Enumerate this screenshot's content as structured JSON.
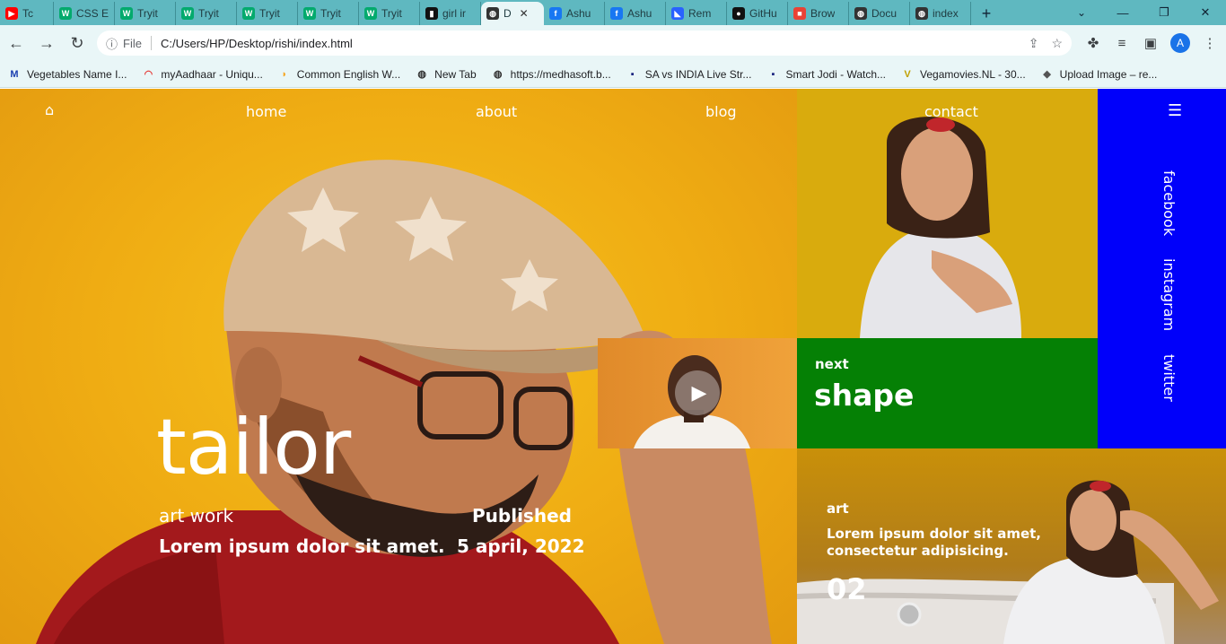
{
  "browser": {
    "tabs": [
      {
        "label": "Tc",
        "icon": "youtube-icon",
        "color": "#ff0000"
      },
      {
        "label": "CSS E",
        "icon": "w3schools-icon",
        "color": "#04aa6d"
      },
      {
        "label": "Tryit",
        "icon": "w3schools-icon",
        "color": "#04aa6d"
      },
      {
        "label": "Tryit",
        "icon": "w3schools-icon",
        "color": "#04aa6d"
      },
      {
        "label": "Tryit",
        "icon": "w3schools-icon",
        "color": "#04aa6d"
      },
      {
        "label": "Tryit",
        "icon": "w3schools-icon",
        "color": "#04aa6d"
      },
      {
        "label": "Tryit",
        "icon": "w3schools-icon",
        "color": "#04aa6d"
      },
      {
        "label": "girl ir",
        "icon": "unsplash-icon",
        "color": "#111111"
      },
      {
        "label": "D",
        "icon": "globe-icon",
        "color": "#333333",
        "active": true
      },
      {
        "label": "Ashu",
        "icon": "facebook-icon",
        "color": "#1877f2"
      },
      {
        "label": "Ashu",
        "icon": "facebook-icon",
        "color": "#1877f2"
      },
      {
        "label": "Rem",
        "icon": "remini-icon",
        "color": "#2962ff"
      },
      {
        "label": "GitHu",
        "icon": "github-icon",
        "color": "#111111"
      },
      {
        "label": "Brow",
        "icon": "multicolor-icon",
        "color": "#e94235"
      },
      {
        "label": "Docu",
        "icon": "globe-icon",
        "color": "#333333"
      },
      {
        "label": "index",
        "icon": "globe-icon",
        "color": "#333333"
      }
    ],
    "address": {
      "scheme_label": "File",
      "url": "C:/Users/HP/Desktop/rishi/index.html"
    },
    "profile_initial": "A",
    "bookmarks": [
      {
        "label": "Vegetables Name I...",
        "icon": "m-icon",
        "color": "#1a3fb0"
      },
      {
        "label": "myAadhaar - Uniqu...",
        "icon": "aadhaar-icon",
        "color": "#e53935"
      },
      {
        "label": "Common English W...",
        "icon": "bookmark-icon",
        "color": "#f5a623"
      },
      {
        "label": "New Tab",
        "icon": "globe-icon",
        "color": "#333333"
      },
      {
        "label": "https://medhasoft.b...",
        "icon": "globe-icon",
        "color": "#333333"
      },
      {
        "label": "SA vs INDIA Live Str...",
        "icon": "channel-icon",
        "color": "#1a237e"
      },
      {
        "label": "Smart Jodi - Watch...",
        "icon": "channel-icon",
        "color": "#1a237e"
      },
      {
        "label": "Vegamovies.NL - 30...",
        "icon": "vegamovies-icon",
        "color": "#c0a000"
      },
      {
        "label": "Upload Image – re...",
        "icon": "upload-icon",
        "color": "#555555"
      }
    ]
  },
  "site": {
    "nav": {
      "home": "home",
      "about": "about",
      "blog": "blog",
      "contact": "contact"
    },
    "hero": {
      "title": "tailor",
      "subtitle": "art work",
      "description": "Lorem ipsum dolor sit amet.",
      "published_label": "Published",
      "published_date": "5 april, 2022"
    },
    "next_tile": {
      "small": "next",
      "big": "shape"
    },
    "social": [
      "facebook",
      "instagram",
      "twitter"
    ],
    "art_tile": {
      "label": "art",
      "text": "Lorem ipsum dolor sit amet, consectetur adipisicing.",
      "number": "02"
    },
    "colors": {
      "yellow": "#f2b414",
      "green": "#058005",
      "blue": "#0000fa"
    }
  }
}
